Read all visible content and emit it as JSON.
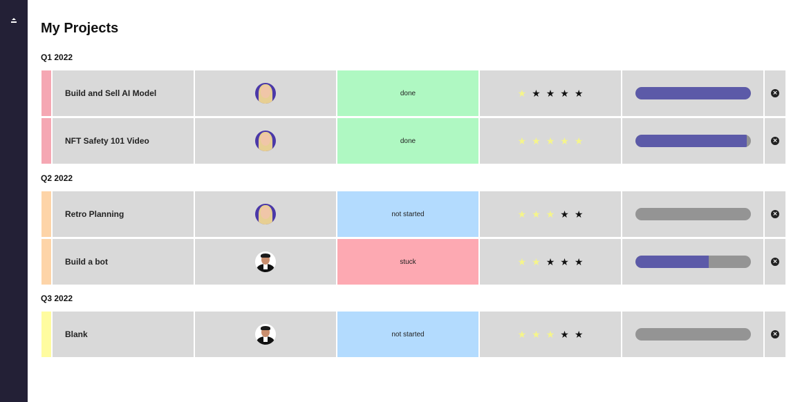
{
  "title": "My Projects",
  "colors": {
    "done": "#aff8c2",
    "not_started": "#b3dbfe",
    "stuck": "#fda9b2",
    "progress_fill": "#5c5aa8",
    "progress_track": "#949494",
    "star_on": "#f5f58a",
    "star_off": "#111111",
    "sidebar": "#232036"
  },
  "icons": {
    "menu": "eject-menu-icon",
    "delete": "close-circle-icon",
    "star": "star-icon"
  },
  "groups": [
    {
      "title": "Q1 2022",
      "color": "#f5a7b3",
      "items": [
        {
          "name": "Build and Sell AI Model",
          "owner": "woman-avatar",
          "status": "done",
          "status_color": "#aff8c2",
          "rating": 1,
          "progress": 1.0
        },
        {
          "name": "NFT Safety 101 Video",
          "owner": "woman-avatar",
          "status": "done",
          "status_color": "#aff8c2",
          "rating": 5,
          "progress": 0.97
        }
      ]
    },
    {
      "title": "Q2 2022",
      "color": "#fdd4a8",
      "items": [
        {
          "name": "Retro Planning",
          "owner": "woman-avatar",
          "status": "not started",
          "status_color": "#b3dbfe",
          "rating": 3,
          "progress": 0
        },
        {
          "name": "Build a bot",
          "owner": "man-avatar",
          "status": "stuck",
          "status_color": "#fda9b2",
          "rating": 2,
          "progress": 0.64
        }
      ]
    },
    {
      "title": "Q3 2022",
      "color": "#fffca0",
      "items": [
        {
          "name": "Blank",
          "owner": "man-avatar",
          "status": "not started",
          "status_color": "#b3dbfe",
          "rating": 3,
          "progress": 0
        }
      ]
    }
  ]
}
